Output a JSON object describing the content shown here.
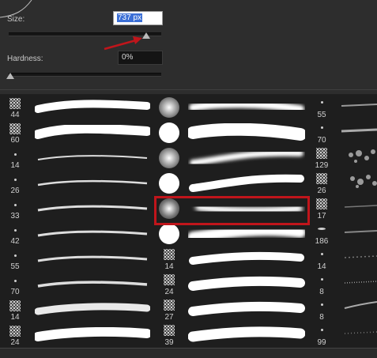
{
  "panel": {
    "size_label": "Size:",
    "size_value": "737 px",
    "hardness_label": "Hardness:",
    "hardness_value": "0%",
    "size_slider_level": 0.93,
    "hardness_slider_level": 0.0
  },
  "brush_columns": [
    {
      "col": 1,
      "items": [
        {
          "size": "44",
          "kind": "scatter"
        },
        {
          "size": "60",
          "kind": "scatter"
        },
        {
          "size": "14",
          "kind": "dot"
        },
        {
          "size": "26",
          "kind": "dot"
        },
        {
          "size": "33",
          "kind": "dot"
        },
        {
          "size": "42",
          "kind": "dot"
        },
        {
          "size": "55",
          "kind": "dot"
        },
        {
          "size": "70",
          "kind": "dot"
        },
        {
          "size": "14",
          "kind": "scatter"
        },
        {
          "size": "24",
          "kind": "scatter"
        }
      ]
    },
    {
      "col": 3,
      "items": [
        {
          "size": "",
          "kind": "soft-circle"
        },
        {
          "size": "",
          "kind": "hard-circle"
        },
        {
          "size": "",
          "kind": "soft-circle"
        },
        {
          "size": "",
          "kind": "hard-circle"
        },
        {
          "size": "",
          "kind": "soft-circle",
          "selected": true
        },
        {
          "size": "",
          "kind": "hard-circle"
        },
        {
          "size": "14",
          "kind": "scatter"
        },
        {
          "size": "24",
          "kind": "scatter"
        },
        {
          "size": "27",
          "kind": "scatter"
        },
        {
          "size": "39",
          "kind": "scatter"
        }
      ]
    },
    {
      "col": 5,
      "items": [
        {
          "size": "55",
          "kind": "dot"
        },
        {
          "size": "70",
          "kind": "dot"
        },
        {
          "size": "129",
          "kind": "scatter"
        },
        {
          "size": "26",
          "kind": "scatter"
        },
        {
          "size": "17",
          "kind": "scatter"
        },
        {
          "size": "186",
          "kind": "dot"
        },
        {
          "size": "14",
          "kind": "dot"
        },
        {
          "size": "8",
          "kind": "dot"
        },
        {
          "size": "8",
          "kind": "dot"
        },
        {
          "size": "99",
          "kind": "dot"
        }
      ]
    }
  ],
  "colors": {
    "panel_bg": "#2d2d2d",
    "grid_bg": "#1e1e1e",
    "highlight": "#c0151b",
    "annotation_arrow": "#c0151b",
    "selection_blue": "#3b6fd6"
  },
  "icons": {
    "annotation": "red-arrow-icon",
    "slider_thumb": "triangle-thumb-icon"
  }
}
